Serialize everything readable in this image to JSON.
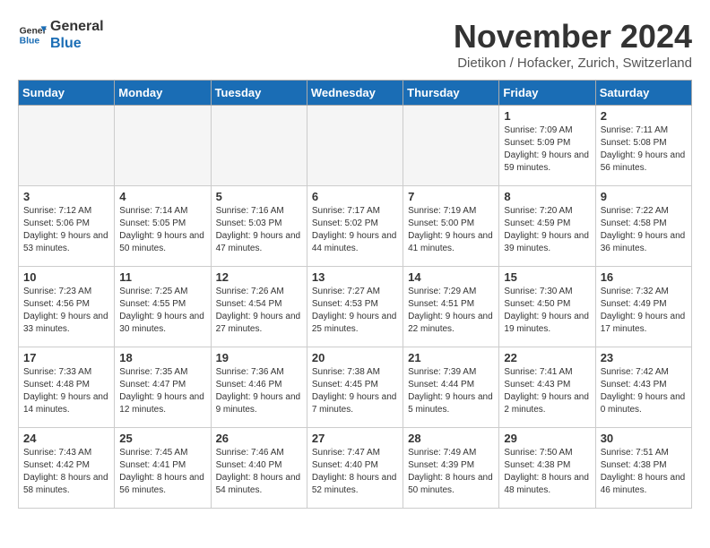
{
  "logo": {
    "line1": "General",
    "line2": "Blue"
  },
  "title": "November 2024",
  "location": "Dietikon / Hofacker, Zurich, Switzerland",
  "headers": [
    "Sunday",
    "Monday",
    "Tuesday",
    "Wednesday",
    "Thursday",
    "Friday",
    "Saturday"
  ],
  "weeks": [
    [
      {
        "day": "",
        "info": ""
      },
      {
        "day": "",
        "info": ""
      },
      {
        "day": "",
        "info": ""
      },
      {
        "day": "",
        "info": ""
      },
      {
        "day": "",
        "info": ""
      },
      {
        "day": "1",
        "info": "Sunrise: 7:09 AM\nSunset: 5:09 PM\nDaylight: 9 hours and 59 minutes."
      },
      {
        "day": "2",
        "info": "Sunrise: 7:11 AM\nSunset: 5:08 PM\nDaylight: 9 hours and 56 minutes."
      }
    ],
    [
      {
        "day": "3",
        "info": "Sunrise: 7:12 AM\nSunset: 5:06 PM\nDaylight: 9 hours and 53 minutes."
      },
      {
        "day": "4",
        "info": "Sunrise: 7:14 AM\nSunset: 5:05 PM\nDaylight: 9 hours and 50 minutes."
      },
      {
        "day": "5",
        "info": "Sunrise: 7:16 AM\nSunset: 5:03 PM\nDaylight: 9 hours and 47 minutes."
      },
      {
        "day": "6",
        "info": "Sunrise: 7:17 AM\nSunset: 5:02 PM\nDaylight: 9 hours and 44 minutes."
      },
      {
        "day": "7",
        "info": "Sunrise: 7:19 AM\nSunset: 5:00 PM\nDaylight: 9 hours and 41 minutes."
      },
      {
        "day": "8",
        "info": "Sunrise: 7:20 AM\nSunset: 4:59 PM\nDaylight: 9 hours and 39 minutes."
      },
      {
        "day": "9",
        "info": "Sunrise: 7:22 AM\nSunset: 4:58 PM\nDaylight: 9 hours and 36 minutes."
      }
    ],
    [
      {
        "day": "10",
        "info": "Sunrise: 7:23 AM\nSunset: 4:56 PM\nDaylight: 9 hours and 33 minutes."
      },
      {
        "day": "11",
        "info": "Sunrise: 7:25 AM\nSunset: 4:55 PM\nDaylight: 9 hours and 30 minutes."
      },
      {
        "day": "12",
        "info": "Sunrise: 7:26 AM\nSunset: 4:54 PM\nDaylight: 9 hours and 27 minutes."
      },
      {
        "day": "13",
        "info": "Sunrise: 7:27 AM\nSunset: 4:53 PM\nDaylight: 9 hours and 25 minutes."
      },
      {
        "day": "14",
        "info": "Sunrise: 7:29 AM\nSunset: 4:51 PM\nDaylight: 9 hours and 22 minutes."
      },
      {
        "day": "15",
        "info": "Sunrise: 7:30 AM\nSunset: 4:50 PM\nDaylight: 9 hours and 19 minutes."
      },
      {
        "day": "16",
        "info": "Sunrise: 7:32 AM\nSunset: 4:49 PM\nDaylight: 9 hours and 17 minutes."
      }
    ],
    [
      {
        "day": "17",
        "info": "Sunrise: 7:33 AM\nSunset: 4:48 PM\nDaylight: 9 hours and 14 minutes."
      },
      {
        "day": "18",
        "info": "Sunrise: 7:35 AM\nSunset: 4:47 PM\nDaylight: 9 hours and 12 minutes."
      },
      {
        "day": "19",
        "info": "Sunrise: 7:36 AM\nSunset: 4:46 PM\nDaylight: 9 hours and 9 minutes."
      },
      {
        "day": "20",
        "info": "Sunrise: 7:38 AM\nSunset: 4:45 PM\nDaylight: 9 hours and 7 minutes."
      },
      {
        "day": "21",
        "info": "Sunrise: 7:39 AM\nSunset: 4:44 PM\nDaylight: 9 hours and 5 minutes."
      },
      {
        "day": "22",
        "info": "Sunrise: 7:41 AM\nSunset: 4:43 PM\nDaylight: 9 hours and 2 minutes."
      },
      {
        "day": "23",
        "info": "Sunrise: 7:42 AM\nSunset: 4:43 PM\nDaylight: 9 hours and 0 minutes."
      }
    ],
    [
      {
        "day": "24",
        "info": "Sunrise: 7:43 AM\nSunset: 4:42 PM\nDaylight: 8 hours and 58 minutes."
      },
      {
        "day": "25",
        "info": "Sunrise: 7:45 AM\nSunset: 4:41 PM\nDaylight: 8 hours and 56 minutes."
      },
      {
        "day": "26",
        "info": "Sunrise: 7:46 AM\nSunset: 4:40 PM\nDaylight: 8 hours and 54 minutes."
      },
      {
        "day": "27",
        "info": "Sunrise: 7:47 AM\nSunset: 4:40 PM\nDaylight: 8 hours and 52 minutes."
      },
      {
        "day": "28",
        "info": "Sunrise: 7:49 AM\nSunset: 4:39 PM\nDaylight: 8 hours and 50 minutes."
      },
      {
        "day": "29",
        "info": "Sunrise: 7:50 AM\nSunset: 4:38 PM\nDaylight: 8 hours and 48 minutes."
      },
      {
        "day": "30",
        "info": "Sunrise: 7:51 AM\nSunset: 4:38 PM\nDaylight: 8 hours and 46 minutes."
      }
    ]
  ]
}
